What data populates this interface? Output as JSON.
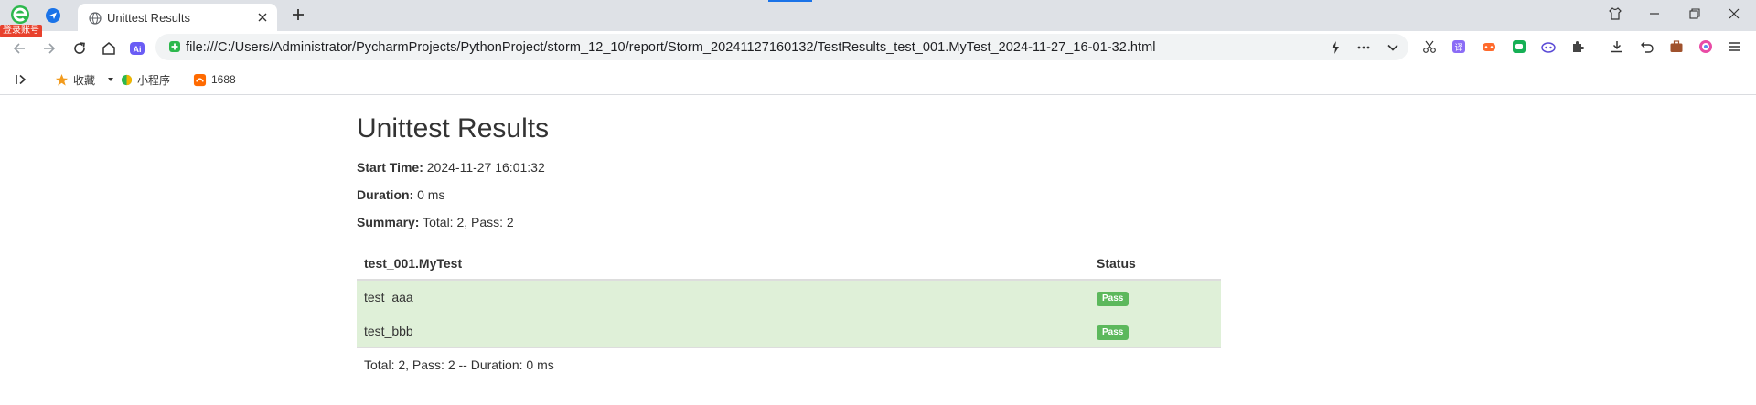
{
  "browser": {
    "login_badge": "登录账号",
    "tab": {
      "title": "Unittest Results"
    },
    "address_bar": {
      "url": "file:///C:/Users/Administrator/PycharmProjects/PythonProject/storm_12_10/report/Storm_20241127160132/TestResults_test_001.MyTest_2024-11-27_16-01-32.html"
    },
    "bookmarks": [
      {
        "label": "收藏",
        "icon": "star-icon"
      },
      {
        "label": "小程序",
        "icon": "miniapp-icon"
      },
      {
        "label": "1688",
        "icon": "1688-icon"
      }
    ]
  },
  "report": {
    "title": "Unittest Results",
    "start_time_label": "Start Time:",
    "start_time": "2024-11-27 16:01:32",
    "duration_label": "Duration:",
    "duration": "0 ms",
    "summary_label": "Summary:",
    "summary": "Total: 2, Pass: 2",
    "table": {
      "headers": [
        "test_001.MyTest",
        "Status"
      ],
      "rows": [
        {
          "name": "test_aaa",
          "status": "Pass"
        },
        {
          "name": "test_bbb",
          "status": "Pass"
        }
      ],
      "footer": "Total: 2, Pass: 2 -- Duration: 0 ms"
    }
  },
  "colors": {
    "pass_badge": "#5cb85c",
    "pass_row": "#dff0d8",
    "accent": "#1a73e8"
  }
}
